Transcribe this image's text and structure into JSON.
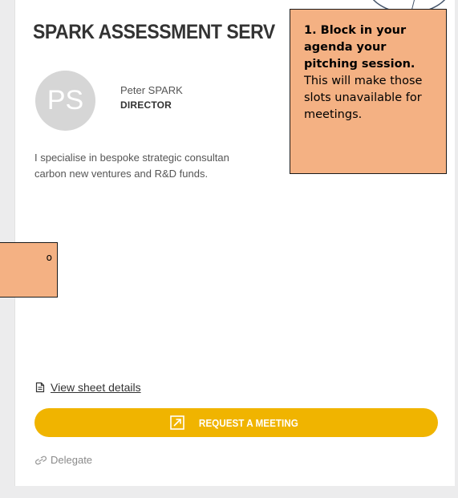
{
  "company": {
    "title": "SPARK ASSESSMENT SERV"
  },
  "person": {
    "initials": "PS",
    "name": "Peter SPARK",
    "role": "DIRECTOR"
  },
  "description": {
    "line1": "I specialise in bespoke strategic consultan",
    "line2": "carbon new ventures and R&D funds."
  },
  "actions": {
    "view_details": "View sheet details",
    "request_meeting": "REQUEST A MEETING",
    "delegate": "Delegate"
  },
  "callouts": {
    "main_bold": "1. Block in your agenda your pitching session.",
    "main_rest": "This will make those slots unavailable for meetings.",
    "left_fragment": "o"
  },
  "colors": {
    "accent": "#f0b400",
    "callout_bg": "#f4b183",
    "avatar_bg": "#d6d6d6"
  },
  "icons": {
    "view_details": "document-icon",
    "request_meeting": "external-arrow-icon",
    "delegate": "link-icon"
  }
}
